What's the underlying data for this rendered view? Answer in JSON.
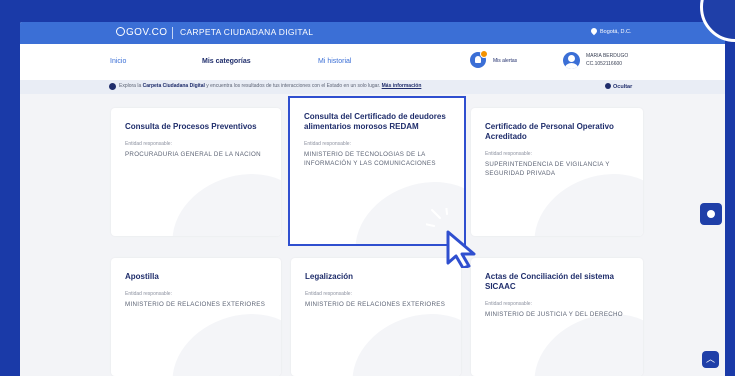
{
  "header": {
    "logo": "GOV.CO",
    "title": "CARPETA CIUDADANA DIGITAL",
    "location": "Bogotá, D.C."
  },
  "nav": {
    "items": [
      {
        "label": "Inicio",
        "active": false
      },
      {
        "label": "Mis categorías",
        "active": true
      },
      {
        "label": "Mi historial",
        "active": false
      }
    ],
    "alerts_label": "Mis alertas",
    "user_name": "MARIA BERDUGO",
    "user_id": "CC.1052116600"
  },
  "info": {
    "prefix": "Explora la ",
    "strong": "Carpeta Ciudadana Digital",
    "middle": " y encuentra los resultados de tus interacciones con el Estado en un solo lugar. ",
    "link": "Más información",
    "hide_label": "Ocultar"
  },
  "cards": [
    {
      "title": "Consulta de Procesos Preventivos",
      "entity_label": "Entidad responsable:",
      "entity": "PROCURADURIA GENERAL DE LA NACION"
    },
    {
      "title": "Consulta del Certificado de deudores alimentarios morosos REDAM",
      "entity_label": "Entidad responsable:",
      "entity": "MINISTERIO DE TECNOLOGIAS DE LA INFORMACIÓN Y LAS COMUNICACIONES"
    },
    {
      "title": "Certificado de Personal Operativo Acreditado",
      "entity_label": "Entidad responsable:",
      "entity": "SUPERINTENDENCIA DE VIGILANCIA Y SEGURIDAD PRIVADA"
    },
    {
      "title": "Apostilla",
      "entity_label": "Entidad responsable:",
      "entity": "MINISTERIO DE RELACIONES EXTERIORES"
    },
    {
      "title": "Legalización",
      "entity_label": "Entidad responsable:",
      "entity": "MINISTERIO DE RELACIONES EXTERIORES"
    },
    {
      "title": "Actas de Conciliación del sistema SICAAC",
      "entity_label": "Entidad responsable:",
      "entity": "MINISTERIO DE JUSTICIA Y DEL DERECHO"
    }
  ],
  "colors": {
    "frame": "#1a3aa8",
    "header": "#3b6fd6",
    "title_text": "#1f2d6b",
    "highlight_border": "#2f4fcf"
  },
  "icons": [
    "govco-logo-icon",
    "location-pin-icon",
    "bell-icon",
    "user-avatar-icon",
    "info-icon",
    "eye-icon",
    "pointer-cursor-icon",
    "help-icon",
    "chevron-up-icon"
  ]
}
